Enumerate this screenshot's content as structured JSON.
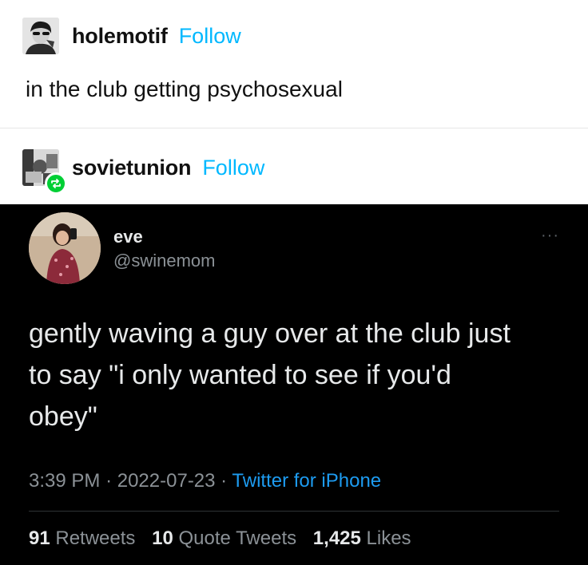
{
  "post1": {
    "username": "holemotif",
    "follow_label": "Follow",
    "caption": "in the club getting psychosexual"
  },
  "post2": {
    "username": "sovietunion",
    "follow_label": "Follow",
    "reblog_icon": "reblog-icon"
  },
  "tweet": {
    "display_name": "eve",
    "handle": "@swinemom",
    "more_label": "···",
    "text": "gently waving a guy over at the club just\nto say \"i only wanted to see if you'd\nobey\"",
    "time": "3:39 PM",
    "date": "2022-07-23",
    "dot": "·",
    "source": "Twitter for iPhone",
    "retweets_count": "91",
    "retweets_label": "Retweets",
    "quotes_count": "10",
    "quotes_label": "Quote Tweets",
    "likes_count": "1,425",
    "likes_label": "Likes"
  },
  "colors": {
    "follow": "#00b8ff",
    "reblog_badge": "#00cf35",
    "tweet_bg": "#000000",
    "twitter_blue": "#1d9bf0",
    "muted": "#8b9196"
  }
}
